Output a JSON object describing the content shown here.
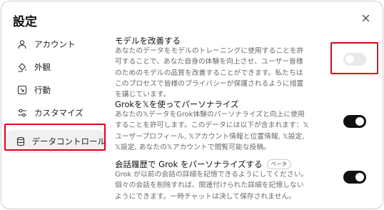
{
  "dialog": {
    "title": "設定"
  },
  "nav": {
    "items": [
      {
        "label": "アカウント",
        "icon": "person-icon"
      },
      {
        "label": "外観",
        "icon": "paint-bucket-icon"
      },
      {
        "label": "行動",
        "icon": "behavior-icon"
      },
      {
        "label": "カスタマイズ",
        "icon": "sliders-icon"
      },
      {
        "label": "データコントロール",
        "icon": "database-icon",
        "active": true
      }
    ]
  },
  "settings": [
    {
      "title": "モデルを改善する",
      "description": "あなたのデータをモデルのトレーニングに使用することを許可することで、あなた自身の体験を向上させ、ユーザー皆様のためのモデルの品質を改善することができます。私たちはこのプロセスで皆様のプライバシーが保護されるように措置を講じています。",
      "enabled": false
    },
    {
      "title": "Grokを𝕏を使ってパーソナライズ",
      "description": "あなたの𝕏データをGrok体験のパーソナライズと向上に使用することを許可します。このデータには以下が含まれます：𝕏ユーザープロフィール, 𝕏アカウント情報と位置情報, 𝕏設定, 𝕏設定, あなたの𝕏アカウントで閲覧可能な投稿。",
      "enabled": true
    },
    {
      "title": "会話履歴で Grok をパーソナライズする",
      "badge": "ベータ",
      "description": "Grok が以前の会話の詳細を記憶できるようにしてください。個々の会話を削除すれば、関連付けられた詳細を記憶しないようにできます。一時チャットは決して保存されません。",
      "enabled": true
    }
  ],
  "colors": {
    "highlight": "#e3001b",
    "toggle_on": "#111111",
    "toggle_off": "#e9e9e9"
  }
}
